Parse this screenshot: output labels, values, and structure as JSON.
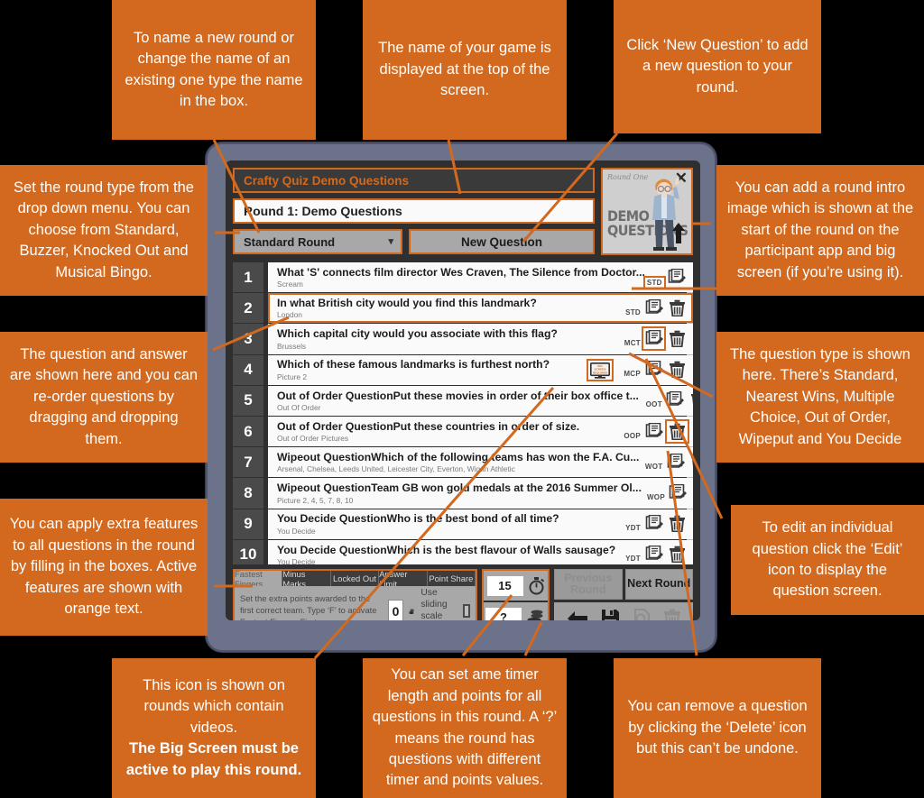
{
  "app": {
    "game_title": "Crafty Quiz Demo Questions",
    "round_name": "Round 1: Demo Questions",
    "round_type": "Standard Round",
    "new_question_label": "New Question",
    "chevron": "⌄"
  },
  "round_intro": {
    "label_small": "Round One",
    "label_line1": "DEMO",
    "label_line2": "QUESTIONS",
    "close": "✕"
  },
  "questions": [
    {
      "num": "1",
      "title": "What 'S' connects film director Wes Craven, The Silence from Doctor...",
      "answer": "Scream",
      "type": "STD",
      "type_boxed": true,
      "edit_boxed": false,
      "delete_boxed": false,
      "bigscreen": false,
      "highlight": false
    },
    {
      "num": "2",
      "title": "In what British city would you find this landmark?",
      "answer": "London",
      "type": "STD",
      "type_boxed": false,
      "edit_boxed": false,
      "delete_boxed": false,
      "bigscreen": false,
      "highlight": true
    },
    {
      "num": "3",
      "title": "Which capital city would you associate with this flag?",
      "answer": "Brussels",
      "type": "MCT",
      "type_boxed": false,
      "edit_boxed": true,
      "delete_boxed": false,
      "bigscreen": false,
      "highlight": false
    },
    {
      "num": "4",
      "title": "Which of these famous landmarks is furthest north?",
      "answer": "Picture 2",
      "type": "MCP",
      "type_boxed": false,
      "edit_boxed": false,
      "delete_boxed": false,
      "bigscreen": true,
      "highlight": false
    },
    {
      "num": "5",
      "title": "Out of Order QuestionPut these movies in order of their box office t...",
      "answer": "Out Of Order",
      "type": "OOT",
      "type_boxed": false,
      "edit_boxed": false,
      "delete_boxed": false,
      "bigscreen": false,
      "highlight": false
    },
    {
      "num": "6",
      "title": "Out of Order QuestionPut these countries in order of size.",
      "answer": "Out of Order Pictures",
      "type": "OOP",
      "type_boxed": false,
      "edit_boxed": false,
      "delete_boxed": true,
      "bigscreen": false,
      "highlight": false
    },
    {
      "num": "7",
      "title": "Wipeout QuestionWhich of the following teams has won the F.A. Cu...",
      "answer": "Arsenal, Chelsea, Leeds United, Leicester City, Everton, Wigan Athletic",
      "type": "WOT",
      "type_boxed": false,
      "edit_boxed": false,
      "delete_boxed": false,
      "bigscreen": false,
      "highlight": false
    },
    {
      "num": "8",
      "title": "Wipeout QuestionTeam GB won gold medals at the 2016 Summer Ol...",
      "answer": "Picture 2, 4, 5, 7, 8, 10",
      "type": "WOP",
      "type_boxed": false,
      "edit_boxed": false,
      "delete_boxed": false,
      "bigscreen": false,
      "highlight": false
    },
    {
      "num": "9",
      "title": "You Decide QuestionWho is the best bond of all time?",
      "answer": "You Decide",
      "type": "YDT",
      "type_boxed": false,
      "edit_boxed": false,
      "delete_boxed": false,
      "bigscreen": false,
      "highlight": false
    },
    {
      "num": "10",
      "title": "You Decide QuestionWhich is the best flavour of Walls sausage?",
      "answer": "You Decide",
      "type": "YDT",
      "type_boxed": false,
      "edit_boxed": false,
      "delete_boxed": false,
      "bigscreen": false,
      "highlight": false
    }
  ],
  "bigscreen_badge": {
    "line1": "BIG",
    "line2": "SCREEN",
    "line3": "REQUIRED"
  },
  "features": {
    "tabs": [
      {
        "label": "Fastest Fingers",
        "active": true
      },
      {
        "label": "Minus Marks",
        "active": false
      },
      {
        "label": "Locked Out",
        "active": false
      },
      {
        "label": "Answer Limit",
        "active": false
      },
      {
        "label": "Point Share",
        "active": false
      }
    ],
    "description": "Set the extra points awarded to the first correct team. Type ‘F’ to activate Fastest Fingers First",
    "points_value": "0",
    "sliding_scale_label": "Use sliding scale system"
  },
  "timer_points": {
    "timer_value": "15",
    "points_value": "?"
  },
  "nav": {
    "previous_round": "Previous Round",
    "next_round": "Next Round"
  },
  "callouts": [
    {
      "id": "name-round",
      "text": "To name a new round or change the name of an existing one type the name in the box."
    },
    {
      "id": "game-name",
      "text": "The name of your game is displayed at the top of the screen."
    },
    {
      "id": "new-question",
      "text": "Click ‘New Question’ to add a new question to your round."
    },
    {
      "id": "round-type",
      "text": "Set the round type from the drop down menu. You can choose from Standard, Buzzer, Knocked Out and Musical Bingo."
    },
    {
      "id": "question-answer",
      "text": "The question and answer are shown here and you can re-order questions by dragging and dropping them."
    },
    {
      "id": "extra-features",
      "text": "You can apply extra features to all questions in the round by filling in the boxes. Active features are shown with orange text."
    },
    {
      "id": "round-intro-image",
      "text": "You can add a round intro image which is shown at the start of the round on the participant app and big screen (if you’re using it)."
    },
    {
      "id": "question-type",
      "text": "The question type is shown here. There’s Standard, Nearest Wins, Multiple Choice, Out of Order, Wipeput and You Decide"
    },
    {
      "id": "edit-question",
      "text": "To edit an individual question click the ‘Edit’ icon to display the question screen."
    },
    {
      "id": "video-icon-normal",
      "text": "This icon is shown on rounds which contain videos."
    },
    {
      "id": "video-icon-bold",
      "text": "The Big Screen must be active to play this round."
    },
    {
      "id": "timer-points",
      "text": "You can set ame timer length and points for all questions in this round. A ‘?’ means the round has questions with different timer and points values."
    },
    {
      "id": "delete-question",
      "text": "You can remove a question by clicking the ‘Delete’ icon but this can’t be undone."
    }
  ],
  "colors": {
    "accent": "#D2691E",
    "device": "#6b7289",
    "screen_bg": "#2f2f2f",
    "row_bg": "#fafafa",
    "panel_grey": "#a8a8a8"
  }
}
